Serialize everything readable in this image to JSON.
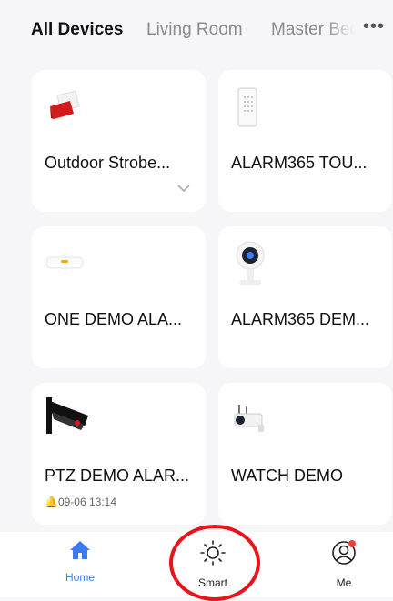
{
  "tabs": {
    "items": [
      "All Devices",
      "Living Room",
      "Master Bed"
    ],
    "active": "All Devices",
    "more_icon": "more-dots-icon"
  },
  "devices": [
    {
      "name": "Outdoor Strobe...",
      "icon": "strobe-siren-icon",
      "meta": "",
      "expand_icon": "chevron-down-icon"
    },
    {
      "name": "ALARM365 TOU...",
      "icon": "keypad-icon",
      "meta": ""
    },
    {
      "name": "ONE DEMO ALA...",
      "icon": "alarm-hub-icon",
      "meta": ""
    },
    {
      "name": "ALARM365 DEM...",
      "icon": "indoor-camera-icon",
      "meta": ""
    },
    {
      "name": "PTZ DEMO ALAR...",
      "icon": "ptz-camera-icon",
      "meta": "09-06 13:14"
    },
    {
      "name": "WATCH DEMO",
      "icon": "outdoor-camera-icon",
      "meta": ""
    }
  ],
  "bottom_nav": {
    "home": "Home",
    "smart": "Smart",
    "me": "Me"
  },
  "colors": {
    "accent": "#3d7bf5",
    "highlight": "#e8141a",
    "badge": "#e8413b"
  }
}
